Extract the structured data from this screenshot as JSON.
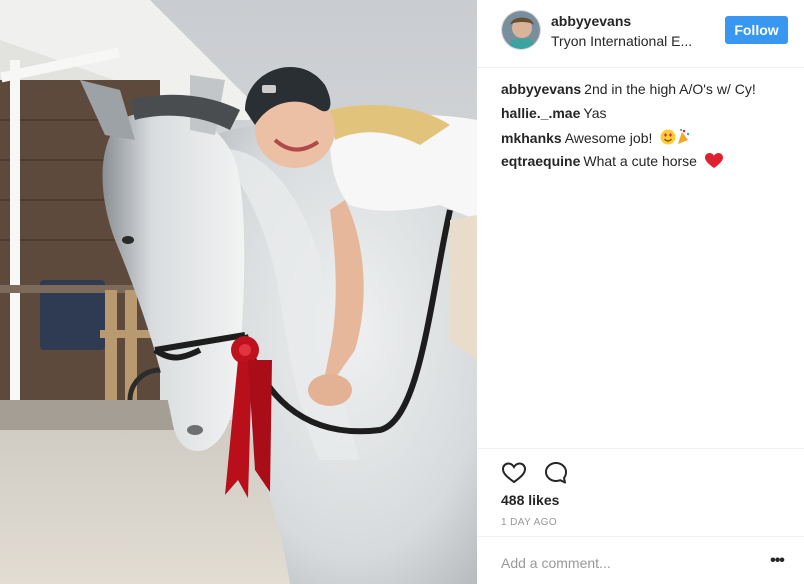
{
  "post": {
    "photo": {
      "icon": "horse-rider-photo"
    },
    "header": {
      "username": "abbyyevans",
      "location": "Tryon International E...",
      "follow_label": "Follow",
      "follow_color": "#3897f0"
    },
    "comments": [
      {
        "user": "abbyyevans",
        "text": "2nd in the high A/O's w/ Cy!",
        "emoji": ""
      },
      {
        "user": "hallie._.mae",
        "text": "Yas",
        "emoji": ""
      },
      {
        "user": "mkhanks",
        "text": "Awesome job!",
        "emoji": "heart-eyes-party-emoji"
      },
      {
        "user": "eqtraequine",
        "text": "What a cute horse",
        "emoji": "red-heart-emoji"
      }
    ],
    "actions": {
      "like_icon": "heart-icon",
      "comment_icon": "comment-bubble-icon"
    },
    "likes": "488 likes",
    "timestamp": "1 DAY AGO",
    "add_comment": {
      "placeholder": "Add a comment...",
      "more_icon": "more-options-icon",
      "more_label": "•••"
    }
  }
}
